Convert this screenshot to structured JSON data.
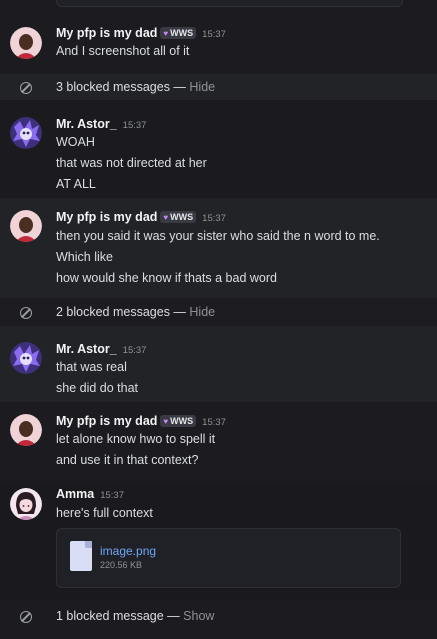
{
  "groups": [
    {
      "author": "My pfp is my dad",
      "tag": "WWS",
      "timestamp": "15:37",
      "lines": [
        "And I screenshot all of it"
      ]
    },
    {
      "author": "Mr. Astor_",
      "timestamp": "15:37",
      "lines": [
        "WOAH",
        "that was not directed at her",
        "AT ALL"
      ]
    },
    {
      "author": "My pfp is my dad",
      "tag": "WWS",
      "timestamp": "15:37",
      "lines": [
        "then you said it was your sister who said the n word to me.",
        "Which like",
        "how would she know if thats a bad word"
      ]
    },
    {
      "author": "Mr. Astor_",
      "timestamp": "15:37",
      "lines": [
        "that was real",
        "she did do that"
      ]
    },
    {
      "author": "My pfp is my dad",
      "tag": "WWS",
      "timestamp": "15:37",
      "lines": [
        "let alone know hwo to spell it",
        "and use it in that context?"
      ]
    },
    {
      "author": "Amma",
      "timestamp": "15:37",
      "lines": [
        "here's full context"
      ],
      "attachment": {
        "filename": "image.png",
        "size": "220.56 KB"
      }
    }
  ],
  "blocked": [
    {
      "text": "3 blocked messages — ",
      "action": "Hide"
    },
    {
      "text": "2 blocked messages — ",
      "action": "Hide"
    },
    {
      "text": "1 blocked message — ",
      "action": "Show"
    }
  ],
  "colors": {
    "background": "#1a1a1e",
    "band": "#222327",
    "link": "#6ea6f5",
    "tag_heart": "#c48bf5"
  },
  "icons": [
    "blocked-icon",
    "file-icon",
    "avatar-dad",
    "avatar-astor",
    "avatar-amma"
  ]
}
